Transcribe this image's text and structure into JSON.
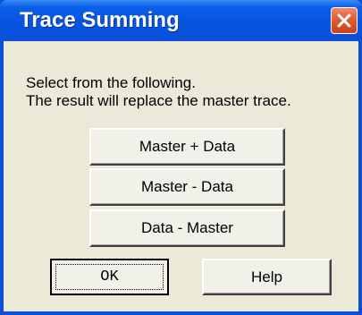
{
  "window": {
    "title": "Trace Summing"
  },
  "message": {
    "line1": "Select from the following.",
    "line2": "The result will replace the master trace."
  },
  "options": [
    {
      "label": "Master + Data"
    },
    {
      "label": "Master - Data"
    },
    {
      "label": "Data - Master"
    }
  ],
  "footer": {
    "ok_label": "OK",
    "help_label": "Help"
  },
  "icons": {
    "close": "close-icon"
  },
  "colors": {
    "titlebar": "#0654e0",
    "close": "#e35a30",
    "face": "#ece9d8"
  }
}
